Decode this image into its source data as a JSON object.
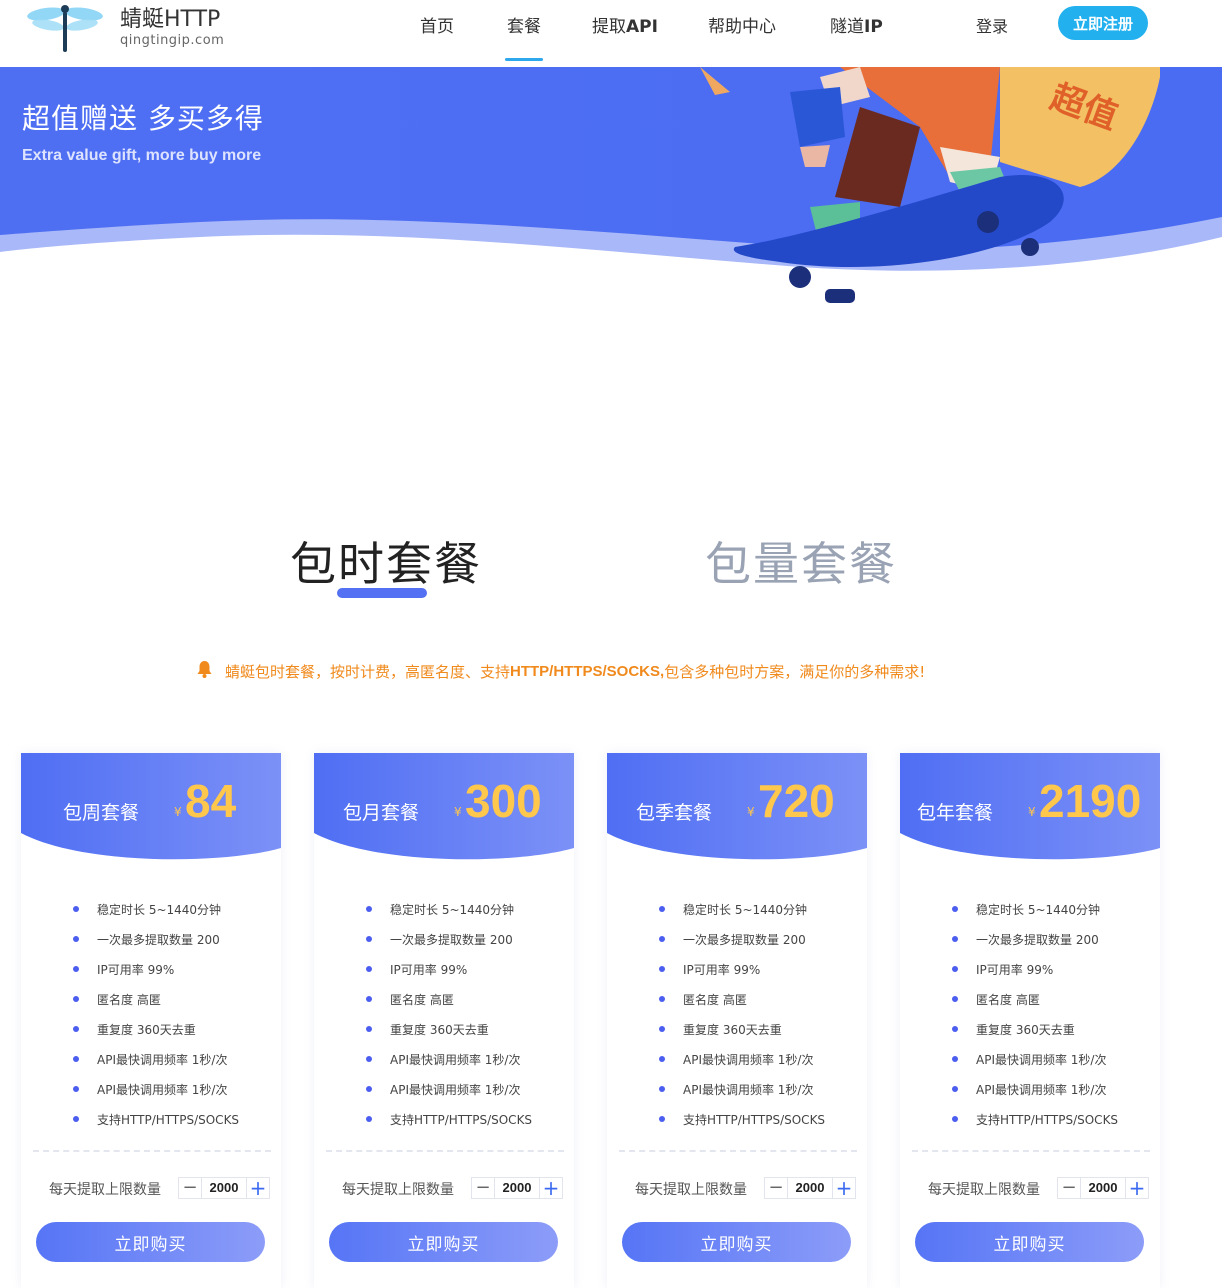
{
  "brand": {
    "name": "蜻蜓HTTP",
    "domain": "qingtingip.com"
  },
  "nav": {
    "items": [
      {
        "label": "首页",
        "active": false
      },
      {
        "label": "套餐",
        "active": true
      },
      {
        "label_pre": "提取",
        "label_bold": "API",
        "active": false
      },
      {
        "label": "帮助中心",
        "active": false
      },
      {
        "label_pre": "隧道",
        "label_bold": "IP",
        "active": false
      }
    ],
    "login": "登录",
    "register": "立即注册"
  },
  "banner": {
    "title": "超值赠送 多买多得",
    "subtitle": "Extra value gift, more buy more",
    "badge_text": "超值"
  },
  "tabs": {
    "hourly": "包时套餐",
    "volume": "包量套餐",
    "active": "hourly"
  },
  "notice": {
    "pre": "蜻蜓包时套餐，按时计费，高匿名度、支持",
    "bold": "HTTP/HTTPS/SOCKS,",
    "post": "包含多种包时方案，满足你的多种需求!"
  },
  "currency": "¥",
  "plans": [
    {
      "name": "包周套餐",
      "price": "84"
    },
    {
      "name": "包月套餐",
      "price": "300"
    },
    {
      "name": "包季套餐",
      "price": "720"
    },
    {
      "name": "包年套餐",
      "price": "2190"
    }
  ],
  "features": [
    "稳定时长 5~1440分钟",
    "一次最多提取数量 200",
    "IP可用率 99%",
    "匿名度 高匿",
    "重复度 360天去重",
    "API最快调用频率 1秒/次",
    "API最快调用频率 1秒/次",
    "支持HTTP/HTTPS/SOCKS"
  ],
  "quantity": {
    "label": "每天提取上限数量",
    "value": "2000",
    "minus": "−",
    "plus": "+"
  },
  "buy_label": "立即购买",
  "colors": {
    "primary": "#5470f3",
    "price": "#ffc74b",
    "accent": "#22b1ee",
    "notice": "#f08a1d"
  }
}
